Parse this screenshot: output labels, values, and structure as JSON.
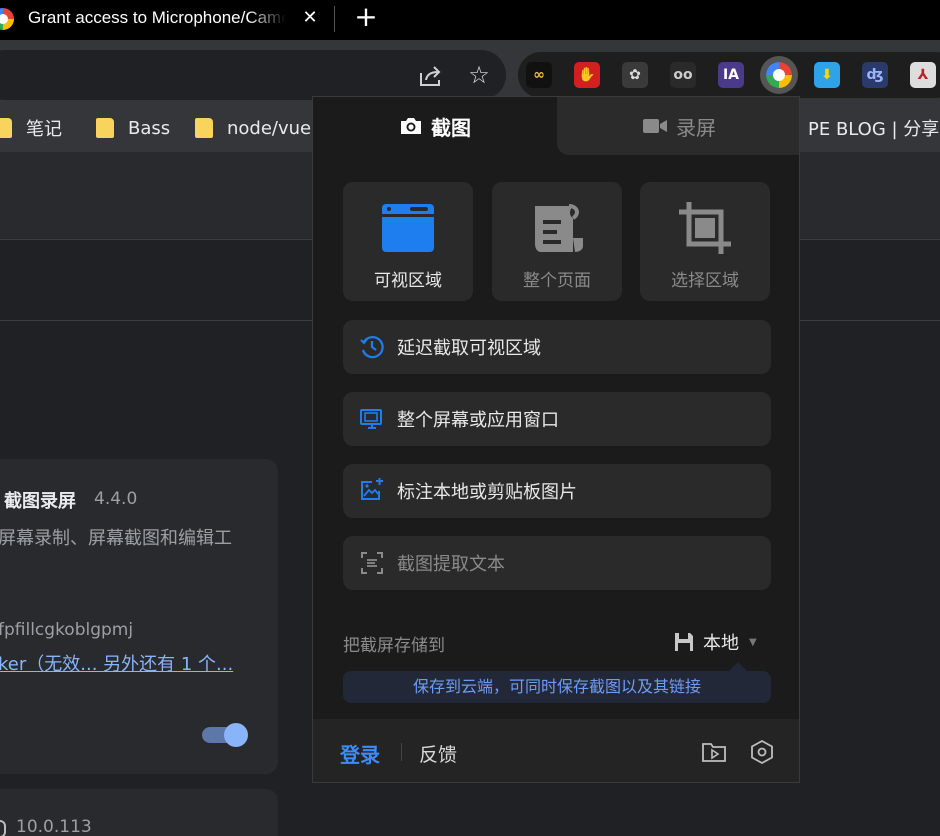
{
  "browser": {
    "tab": {
      "title": "Grant access to Microphone/Camera",
      "close_label": "✕"
    },
    "new_tab_label": "+",
    "extensions": [
      {
        "name": "infinity-extension",
        "label": "∞",
        "bg": "#111111",
        "fg": "#f0c040"
      },
      {
        "name": "stop-hand-extension",
        "label": "✋",
        "bg": "#d22020",
        "fg": "#ffffff"
      },
      {
        "name": "bird-extension",
        "label": "✿",
        "bg": "#3a3a3a",
        "fg": "#dddddd"
      },
      {
        "name": "glasses-extension",
        "label": "oo",
        "bg": "#2a2a2a",
        "fg": "#cccccc"
      },
      {
        "name": "ia-extension",
        "label": "IA",
        "bg": "#4b3a8a",
        "fg": "#ffffff"
      },
      {
        "name": "screenshot-extension",
        "label": "",
        "bg": "#555555",
        "fg": "#ffffff"
      },
      {
        "name": "download-extension",
        "label": "⬇",
        "bg": "#2ea3e8",
        "fg": "#ffd400"
      },
      {
        "name": "tampermonkey-extension",
        "label": "ʤ",
        "bg": "#2a3a6a",
        "fg": "#9ab4ff"
      },
      {
        "name": "pdf-extension",
        "label": "⅄",
        "bg": "#dddddd",
        "fg": "#c02020"
      }
    ]
  },
  "bookmarks": [
    {
      "label": "笔记"
    },
    {
      "label": "Bass"
    },
    {
      "label": "node/vue"
    },
    {
      "label": "PE BLOG | 分享生"
    }
  ],
  "page": {
    "card": {
      "title": "截图录屏",
      "version": "4.4.0",
      "description": "屏幕录制、屏幕截图和编辑工",
      "id_text": "fpfillcgkoblgpmj",
      "link_text": "ker（无效... 另外还有 1 个..."
    },
    "card2": {
      "version": "10.0.113"
    }
  },
  "popup": {
    "tabs": [
      {
        "label": "截图",
        "active": true
      },
      {
        "label": "录屏",
        "active": false
      }
    ],
    "modes": [
      {
        "label": "可视区域",
        "icon": "browser-window-icon"
      },
      {
        "label": "整个页面",
        "icon": "scroll-page-icon"
      },
      {
        "label": "选择区域",
        "icon": "crop-icon"
      }
    ],
    "actions": [
      {
        "label": "延迟截取可视区域",
        "icon": "timer-icon"
      },
      {
        "label": "整个屏幕或应用窗口",
        "icon": "monitor-icon"
      },
      {
        "label": "标注本地或剪贴板图片",
        "icon": "image-edit-icon"
      },
      {
        "label": "截图提取文本",
        "icon": "text-scan-icon"
      }
    ],
    "save": {
      "label": "把截屏存储到",
      "value": "本地",
      "tip": "保存到云端，可同时保存截图以及其链接"
    },
    "footer": {
      "login_label": "登录",
      "feedback_label": "反馈"
    },
    "colors": {
      "accent": "#3d8bf7",
      "panel": "#1b1b1b",
      "button": "#2a2a2a"
    }
  }
}
